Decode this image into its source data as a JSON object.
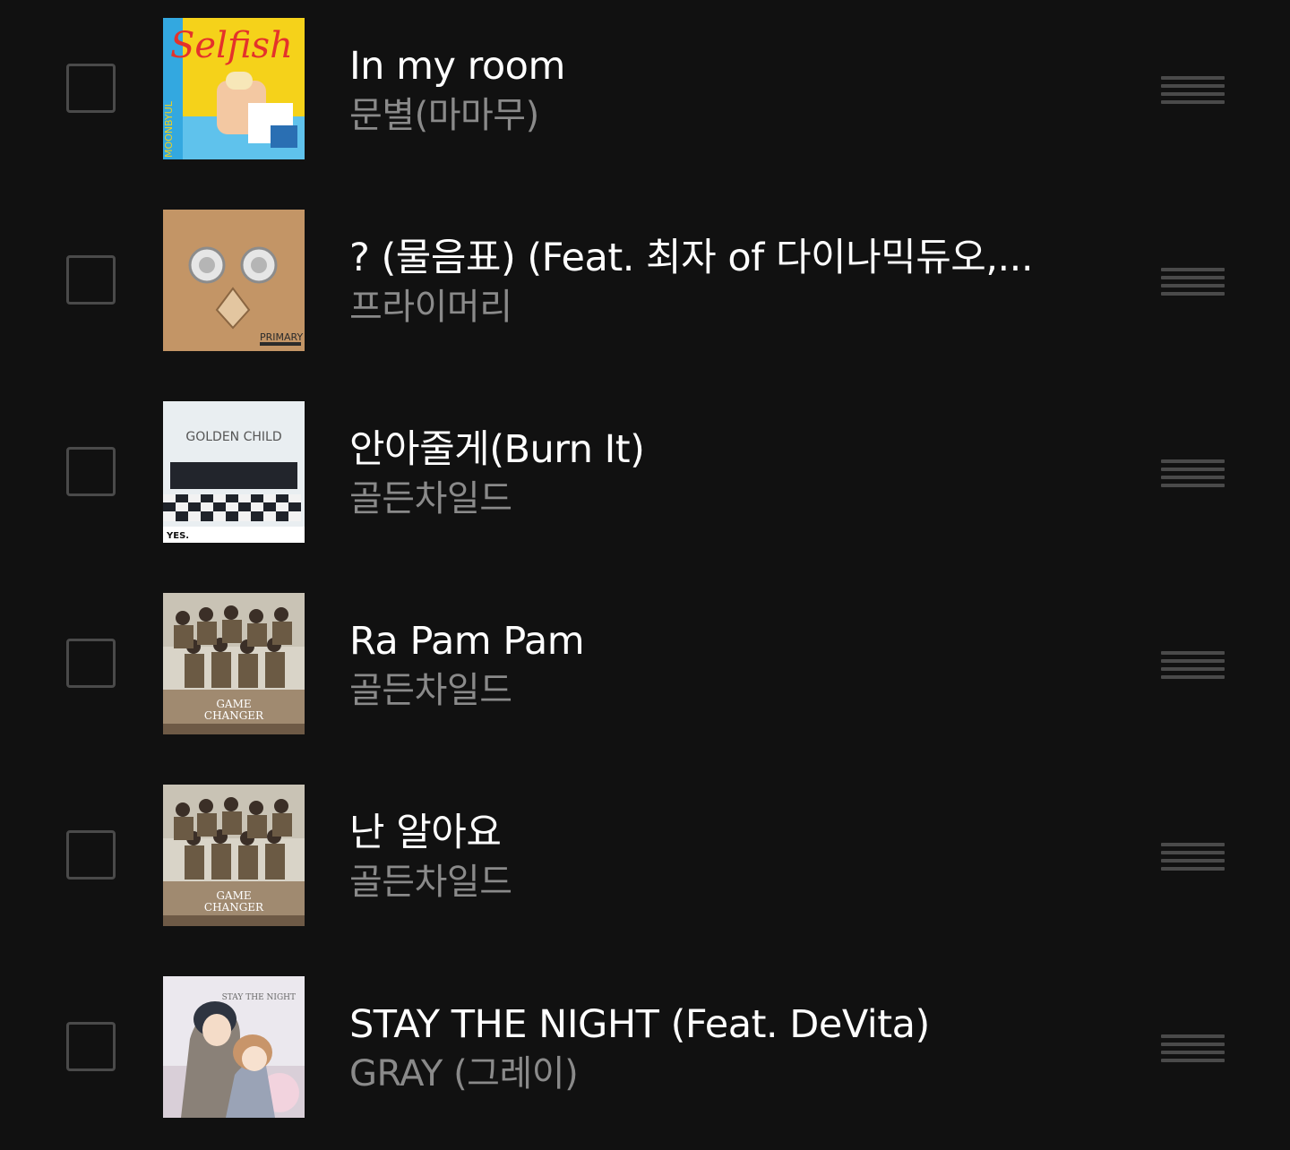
{
  "playlist": {
    "tracks": [
      {
        "title": "In my room",
        "artist": "문별(마마무)",
        "art_icon": "album-art-selfish",
        "art_text": [
          "Selfish",
          "MOONBYUL"
        ]
      },
      {
        "title": "? (물음표) (Feat. 최자 of 다이나믹듀오,...",
        "artist": "프라이머리",
        "art_icon": "album-art-primary",
        "art_text": [
          "PRIMARY"
        ]
      },
      {
        "title": "안아줄게(Burn It)",
        "artist": "골든차일드",
        "art_icon": "album-art-golden-child-yes",
        "art_text": [
          "GOLDEN CHILD",
          "YES."
        ]
      },
      {
        "title": "Ra Pam Pam",
        "artist": "골든차일드",
        "art_icon": "album-art-game-changer",
        "art_text": [
          "GAME",
          "CHANGER"
        ]
      },
      {
        "title": "난 알아요",
        "artist": "골든차일드",
        "art_icon": "album-art-game-changer",
        "art_text": [
          "GAME",
          "CHANGER"
        ]
      },
      {
        "title": "STAY THE NIGHT (Feat. DeVita)",
        "artist": "GRAY (그레이)",
        "art_icon": "album-art-stay-the-night",
        "art_text": [
          "STAY THE NIGHT"
        ]
      }
    ]
  }
}
